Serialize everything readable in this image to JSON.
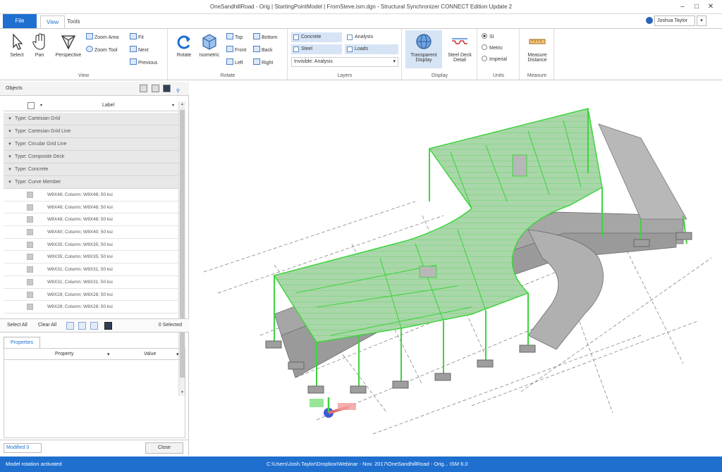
{
  "window": {
    "title": "OneSandhillRoad - Orig | StartingPointModel | FromSteve.ism.dgn - Structural Synchronizer CONNECT Edition Update 2",
    "minimize": "–",
    "maximize": "□",
    "close": "✕"
  },
  "tabs": {
    "file": "File",
    "view": "View",
    "tools": "Tools"
  },
  "user": {
    "name": "Joshua Taylor",
    "menu": "▾"
  },
  "ribbon": {
    "view": {
      "label": "View",
      "select": "Select",
      "pan": "Pan",
      "perspective": "Perspective",
      "zoom_area": "Zoom Area",
      "zoom_tool": "Zoom Tool",
      "fit": "Fit",
      "next": "Next",
      "previous": "Previous"
    },
    "rotate": {
      "label": "Rotate",
      "rotate": "Rotate",
      "isometric": "Isometric",
      "top": "Top",
      "bottom": "Bottom",
      "front": "Front",
      "back": "Back",
      "left": "Left",
      "right": "Right"
    },
    "layers": {
      "label": "Layers",
      "concrete": "Concrete",
      "analysis": "Analysis",
      "steel": "Steel",
      "loads": "Loads",
      "combo_value": "Invisible: Analysis"
    },
    "display": {
      "label": "Display",
      "transparent": "Transparent Display",
      "steel_deck": "Steel Deck Detail"
    },
    "units": {
      "label": "Units",
      "options": [
        "SI",
        "Metric",
        "Imperial"
      ],
      "selected": "SI"
    },
    "measure": {
      "label": "Measure",
      "measure_distance": "Measure Distance"
    }
  },
  "objects_panel": {
    "title": "Objects",
    "header": {
      "label": "Label",
      "sort": "▾",
      "filter": "▾"
    },
    "groups": [
      {
        "label": "Type: Cartesian Grid"
      },
      {
        "label": "Type: Cartesian Grid Line"
      },
      {
        "label": "Type: Circular Grid Line"
      },
      {
        "label": "Type: Composite Deck"
      },
      {
        "label": "Type: Concrete"
      },
      {
        "label": "Type: Curve Member"
      }
    ],
    "items": [
      "W8X48; Column; W8X48; 50 ksi",
      "W8X48; Column; W8X48; 50 ksi",
      "W8X48; Column; W8X48; 50 ksi",
      "W8X40; Column; W8X40; 50 ksi",
      "W8X35; Column; W8X35; 50 ksi",
      "W8X35; Column; W8X35; 50 ksi",
      "W8X31; Column; W8X31; 50 ksi",
      "W8X31; Column; W8X31; 50 ksi",
      "W8X28; Column; W8X28; 50 ksi",
      "W8X28; Column; W8X28; 50 ksi"
    ],
    "select_all": "Select All",
    "clear_all": "Clear All",
    "selected_count": "0 Selected"
  },
  "properties_panel": {
    "tab": "Properties",
    "col_property": "Property",
    "col_value": "Value",
    "modified_field": "Modified 0",
    "close": "Close"
  },
  "status": {
    "left": "Model rotation activated",
    "right": "C:\\Users\\Josh.Taylor\\Dropbox\\Webinar - Nov. 2017\\OneSandhillRoad - Orig...  ISM 6.0"
  },
  "colors": {
    "accent": "#1f6fcf",
    "steel_green": "#3fd43f",
    "slab_grey": "#9a9a9a"
  }
}
